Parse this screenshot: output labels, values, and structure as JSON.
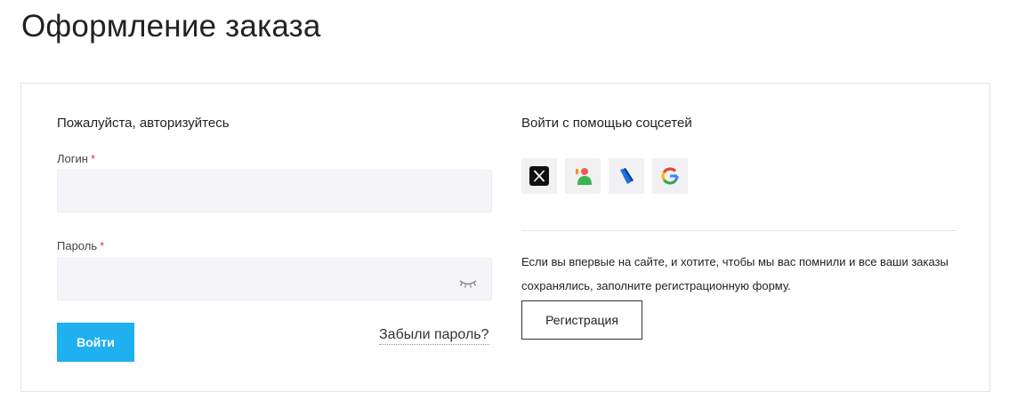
{
  "page": {
    "title": "Оформление заказа"
  },
  "login": {
    "heading": "Пожалуйста, авторизуйтесь",
    "login_label": "Логин",
    "password_label": "Пароль",
    "required_mark": "*",
    "login_value": "",
    "password_value": "",
    "submit_label": "Войти",
    "forgot_label": "Забыли пароль?"
  },
  "social": {
    "heading": "Войти с помощью соцсетей",
    "providers": [
      {
        "icon": "x-icon"
      },
      {
        "icon": "person-icon"
      },
      {
        "icon": "flag-icon"
      },
      {
        "icon": "google-icon"
      }
    ]
  },
  "register": {
    "text": "Если вы впервые на сайте, и хотите, чтобы мы вас помнили и все ваши заказы сохранялись, заполните регистрационную форму.",
    "button_label": "Регистрация"
  },
  "colors": {
    "accent": "#1eb0ef",
    "required": "#e0363d",
    "input_bg": "#f5f5f9"
  }
}
